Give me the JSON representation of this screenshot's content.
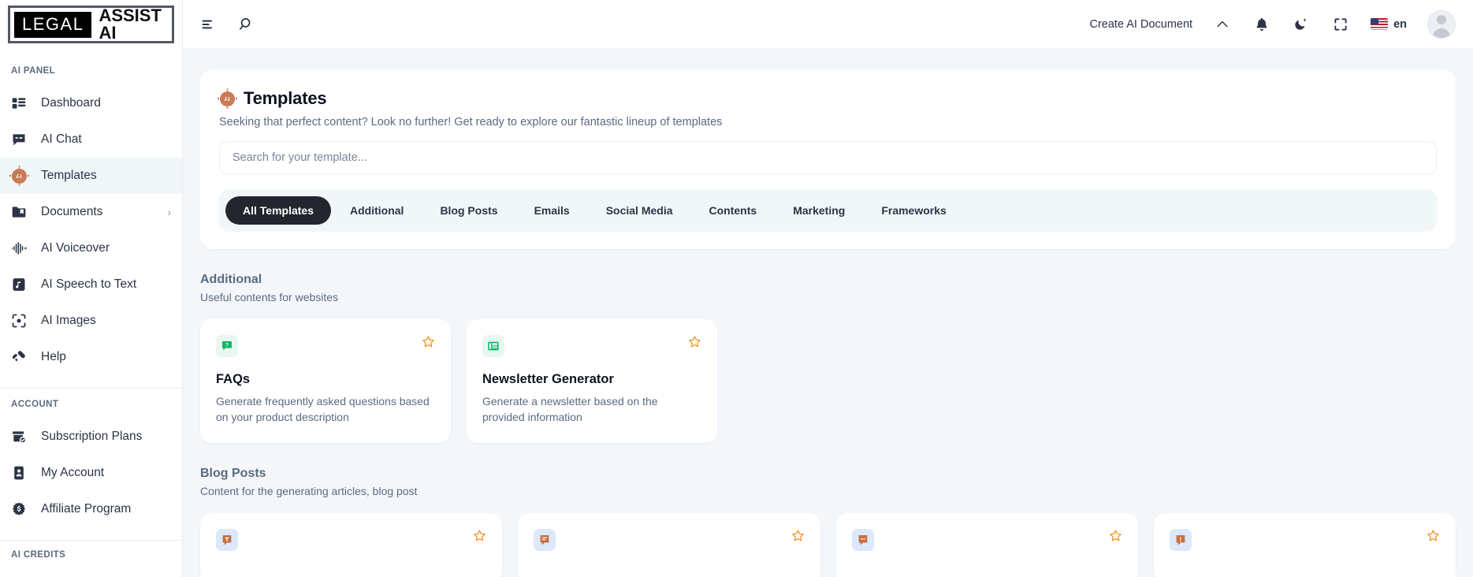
{
  "brand": {
    "logo_mark": "LEGAL",
    "logo_text": "ASSIST AI"
  },
  "sidebar": {
    "sections": [
      {
        "label": "AI PANEL",
        "items": [
          {
            "label": "Dashboard",
            "icon": "dashboard-icon",
            "active": false,
            "chevron": ""
          },
          {
            "label": "AI Chat",
            "icon": "chat-icon",
            "active": false,
            "chevron": ""
          },
          {
            "label": "Templates",
            "icon": "ai-chip-icon",
            "active": true,
            "chevron": ""
          },
          {
            "label": "Documents",
            "icon": "folder-icon",
            "active": false,
            "chevron": "›"
          },
          {
            "label": "AI Voiceover",
            "icon": "waveform-icon",
            "active": false,
            "chevron": ""
          },
          {
            "label": "AI Speech to Text",
            "icon": "audio-file-icon",
            "active": false,
            "chevron": ""
          },
          {
            "label": "AI Images",
            "icon": "camera-icon",
            "active": false,
            "chevron": ""
          },
          {
            "label": "Help",
            "icon": "megaphone-icon",
            "active": false,
            "chevron": ""
          }
        ]
      },
      {
        "label": "ACCOUNT",
        "items": [
          {
            "label": "Subscription Plans",
            "icon": "box-check-icon",
            "active": false,
            "chevron": ""
          },
          {
            "label": "My Account",
            "icon": "id-card-icon",
            "active": false,
            "chevron": ""
          },
          {
            "label": "Affiliate Program",
            "icon": "dollar-badge-icon",
            "active": false,
            "chevron": ""
          }
        ]
      }
    ],
    "bottom_label": "AI CREDITS"
  },
  "topbar": {
    "menu_icon": "hamburger-icon",
    "search_icon": "search-icon",
    "create_document": "Create AI Document",
    "chevron_up_icon": "chevron-up-icon",
    "bell_icon": "bell-icon",
    "dark_mode_icon": "moon-icon",
    "fullscreen_icon": "fullscreen-icon",
    "language": "en",
    "flag": "us-flag-icon",
    "avatar": "user-avatar"
  },
  "page": {
    "title": "Templates",
    "title_icon": "ai-chip-icon",
    "subtitle": "Seeking that perfect content? Look no further! Get ready to explore our fantastic lineup of templates",
    "search": {
      "value": "",
      "placeholder": "Search for your template..."
    },
    "tabs": [
      {
        "label": "All Templates",
        "active": true
      },
      {
        "label": "Additional",
        "active": false
      },
      {
        "label": "Blog Posts",
        "active": false
      },
      {
        "label": "Emails",
        "active": false
      },
      {
        "label": "Social Media",
        "active": false
      },
      {
        "label": "Contents",
        "active": false
      },
      {
        "label": "Marketing",
        "active": false
      },
      {
        "label": "Frameworks",
        "active": false
      }
    ]
  },
  "groups": [
    {
      "title": "Additional",
      "subtitle": "Useful contents for websites",
      "cards": [
        {
          "name": "FAQs",
          "desc": "Generate frequently asked questions based on your product description",
          "icon": "question-bubble-icon",
          "icon_color": "#12b76a",
          "icon_bg": "#e8f8f0",
          "star": "star-outline-icon"
        },
        {
          "name": "Newsletter Generator",
          "desc": "Generate a newsletter based on the provided information",
          "icon": "newspaper-icon",
          "icon_color": "#12b76a",
          "icon_bg": "#e8f8f0",
          "star": "star-outline-icon"
        }
      ]
    },
    {
      "title": "Blog Posts",
      "subtitle": "Content for the generating articles, blog post",
      "cards": [
        {
          "name": "",
          "desc": "",
          "icon": "text-bubble-icon",
          "icon_color": "#c8703f",
          "icon_bg": "#dbe9fb",
          "star": "star-outline-icon"
        },
        {
          "name": "",
          "desc": "",
          "icon": "lines-bubble-icon",
          "icon_color": "#c8703f",
          "icon_bg": "#dbe9fb",
          "star": "star-outline-icon"
        },
        {
          "name": "",
          "desc": "",
          "icon": "dots-bubble-icon",
          "icon_color": "#c8703f",
          "icon_bg": "#dbe9fb",
          "star": "star-outline-icon"
        },
        {
          "name": "",
          "desc": "",
          "icon": "exclaim-bubble-icon",
          "icon_color": "#c8703f",
          "icon_bg": "#dbe9fb",
          "star": "star-outline-icon"
        }
      ]
    }
  ],
  "colors": {
    "accent_orange": "#f5911e",
    "accent_terracotta": "#c8703f",
    "green": "#12b76a",
    "dark": "#23262f",
    "page_bg": "#f3f7fa",
    "muted": "#5b6a82"
  }
}
